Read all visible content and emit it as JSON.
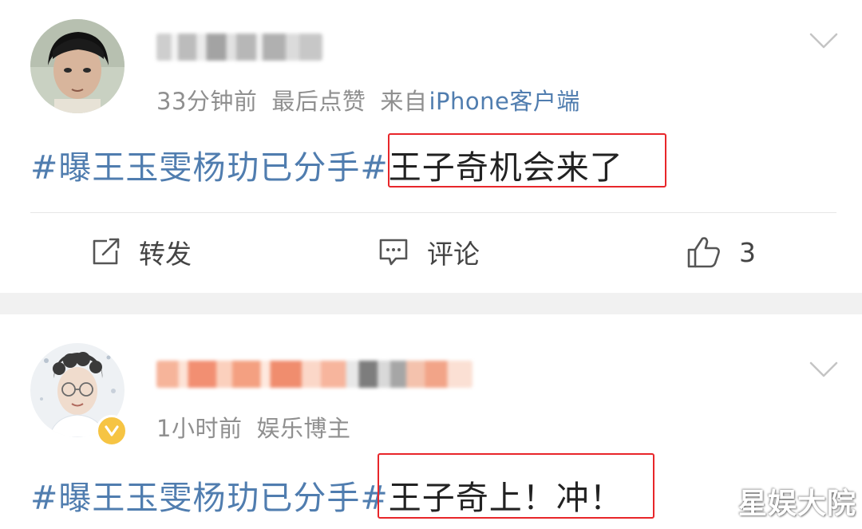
{
  "posts": [
    {
      "meta": {
        "time": "33分钟前",
        "interaction": "最后点赞",
        "source_label": "来自",
        "source_app": "iPhone客户端"
      },
      "hashtag": "#曝王玉雯杨玏已分手#",
      "text": "王子奇机会来了",
      "actions": {
        "repost_label": "转发",
        "comment_label": "评论",
        "like_count": "3"
      }
    },
    {
      "meta": {
        "time": "1小时前",
        "badge_label": "娱乐博主"
      },
      "hashtag": "#曝王玉雯杨玏已分手#",
      "text": "王子奇上！冲！"
    }
  ],
  "watermark": "星娱大院",
  "icons": {
    "repost": "edit-share-icon",
    "comment": "comment-bubble-icon",
    "like": "thumbs-up-icon",
    "more": "chevron-down-icon",
    "verified": "verified-badge-icon"
  },
  "colors": {
    "link": "#507daf",
    "meta": "#8f8f8f",
    "highlight": "#e8262a",
    "separator": "#f1f1f1",
    "verified": "#f6c443"
  }
}
